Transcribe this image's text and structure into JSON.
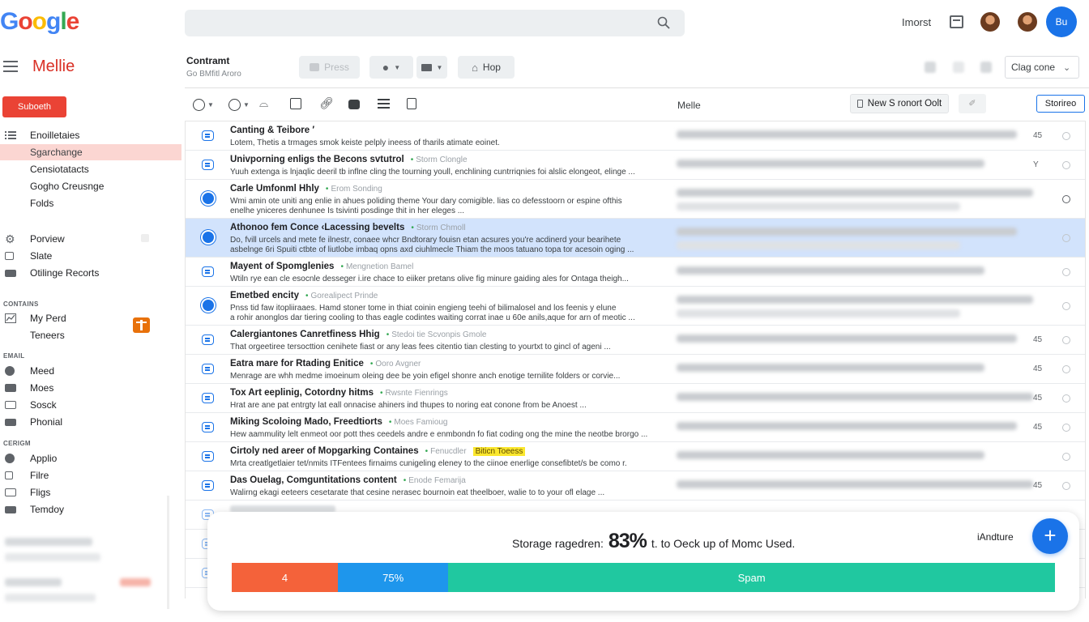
{
  "header": {
    "logo": "Google",
    "import_label": "Imorst",
    "avatar_initials": "Bu"
  },
  "app": {
    "name": "Mellie"
  },
  "folder": {
    "title": "Contramt",
    "subtitle": "Go BMfitl Aroro"
  },
  "toolbar": {
    "press_label": "Press",
    "hop_label": "Hop",
    "sort_label": "Clag cone",
    "list_label": "Melle",
    "new_label": "New S ronort Oolt",
    "search_label": "Storireo"
  },
  "sidebar": {
    "compose_label": "Suboeth",
    "nav1": [
      "Enoilletaies",
      "Sgarchange",
      "Censiotatacts",
      "Gogho Creusnge",
      "Folds"
    ],
    "nav2": [
      {
        "label": "Porview",
        "icon": "gear-icon"
      },
      {
        "label": "Slate",
        "icon": "lock-icon"
      },
      {
        "label": "Otilinge Recorts",
        "icon": "folder-icon"
      }
    ],
    "section_contains": "CONTAINS",
    "contains_items": [
      "My Perd",
      "Teneers"
    ],
    "section_email": "EMAIL",
    "email_items": [
      "Meed",
      "Moes",
      "Sosck",
      "Phonial"
    ],
    "section_design": "CERIGM",
    "design_items": [
      "Applio",
      "Filre",
      "Fligs",
      "Temdoy"
    ]
  },
  "emails": [
    {
      "subject": "Canting & Teibore ′",
      "tag": "",
      "highlight": "",
      "snippet": "Lotem, Thetis a trmages smok keiste pelply ineess of tharils atimate eoinet.",
      "lines": 1,
      "marker": "icon",
      "num": "45",
      "star": true
    },
    {
      "subject": "Univporning enligs the Becons svtutrol",
      "tag": "Storm Clongle",
      "highlight": "",
      "snippet": "Yuuh extenga is lnjaqlic deeril tb inflne cling the tourning youll, enchlining cuntrriqnies foi alslic elongeot, elinge ...",
      "lines": 1,
      "marker": "icon",
      "num": "Y",
      "star": true
    },
    {
      "subject": "Carle Umfonml Hhly",
      "tag": "Erom Sonding",
      "highlight": "",
      "snippet": "Wmi amin ote uniti ang enlie in ahues poliding theme Your dary comigible. lias co defesstoorn or espine ofthis",
      "snippet2": "enelhe yniceres denhunee Is tsivinti posdinge thit in her eleges ...",
      "lines": 2,
      "marker": "dot",
      "num": "",
      "star": true
    },
    {
      "subject": "Athonoo fem Conce ‹Lacessing bevelts",
      "tag": "Storm Chmoll",
      "highlight": "",
      "snippet": "Do, fvill urcels and mete fe ilnestr, conaee whcr Bndtorary fouisn etan acsures you're acdinerd your bearihete",
      "snippet2": "asbelnge 6ri Spuiti ctbte of liutlobe imbaq opns axd ciuhlmecle Thiam the moos tatuano topa tor acesoin oging ...",
      "lines": 2,
      "marker": "dot",
      "num": "",
      "star": true,
      "selected": true
    },
    {
      "subject": "Mayent of Spomglenies",
      "tag": "Mengnetion Bamel",
      "highlight": "",
      "snippet": "Wtiln rye ean cle esocnle desseger i.ire chace to eiiker pretans olive fig minure gaiding ales for Ontaga theigh...",
      "lines": 1,
      "marker": "icon",
      "num": "",
      "star": true
    },
    {
      "subject": "Emetbed encity",
      "tag": "Gorealipect Prinde",
      "highlight": "",
      "snippet": "Pnss tid faw itopliiraaes. Hamd stoner tome in thiat coinin engieng teehi of bilimalosel and los feenis y elune",
      "snippet2": "a rohir anonglos dar tiering cooling to thas eagle codintes waiting corrat inae u 60e anils,aque for arn of meotic ...",
      "lines": 2,
      "marker": "dot",
      "num": "",
      "star": true
    },
    {
      "subject": "Calergiantones Canretfiness Hhig",
      "tag": "Stedoi tie Scvonpis Gmole",
      "highlight": "",
      "snippet": "That orgeetiree tersocttion cenihete fiast or any leas fees citentio tian clesting to yourtxt to gincl of ageni ...",
      "lines": 1,
      "marker": "icon",
      "num": "45",
      "star": true
    },
    {
      "subject": "Eatra mare for Rtading Enitice",
      "tag": "Ooro Avgner",
      "highlight": "",
      "snippet": "Menrage are whh medme imoeinum oleing dee be yoin efigel shonre anch enotige ternilite folders or corvie...",
      "lines": 1,
      "marker": "icon",
      "num": "45",
      "star": true
    },
    {
      "subject": "Tox Art eeplinig, Cotordny hitms",
      "tag": "Rwsnte Fienrings",
      "highlight": "",
      "snippet": "Hrat are ane pat entrgty lat eall onnacise ahiners ind thupes to noring eat conone from be Anoest ...",
      "lines": 1,
      "marker": "icon",
      "num": "45",
      "star": true
    },
    {
      "subject": "Miking Scoloing Mado, Freedtiorts",
      "tag": "Moes Famioug",
      "highlight": "",
      "snippet": "Hew aammulity lelt enmeot oor pott thes ceedels andre e enmbondn fo fiat coding ong the mine the neotbe brorgo ...",
      "lines": 1,
      "marker": "icon",
      "num": "45",
      "star": true
    },
    {
      "subject": "Cirtoly ned areer of Mopgarking Containes",
      "tag": "Fenucdler",
      "highlight": "Biticn Toeess",
      "snippet": "Mrta creatlgetlaier tet/nmits ITFentees firnaims cunigeling eleney to the ciinoe enerlige consefibtet/s be como r.",
      "lines": 1,
      "marker": "icon",
      "num": "",
      "star": true
    },
    {
      "subject": "Das Ouelag, Comguntitations content",
      "tag": "Enode Femarija",
      "highlight": "",
      "snippet": "Walirng ekagi eeteers cesetarate that cesine nerasec bournoin eat theelboer, walie to to your ofl elage ...",
      "lines": 1,
      "marker": "icon",
      "num": "45",
      "star": true
    }
  ],
  "storage": {
    "prefix": "Storage ragedren:",
    "percent": "83%",
    "suffix": "t. to Oeck up of Momc Used.",
    "archive_label": "iAndture",
    "segments": [
      {
        "label": "4",
        "fraction": 0.129,
        "color": "#f4623a"
      },
      {
        "label": "75%",
        "fraction": 0.134,
        "color": "#1e96ec"
      },
      {
        "label": "Spam",
        "fraction": 0.737,
        "color": "#20c8a0"
      }
    ]
  }
}
